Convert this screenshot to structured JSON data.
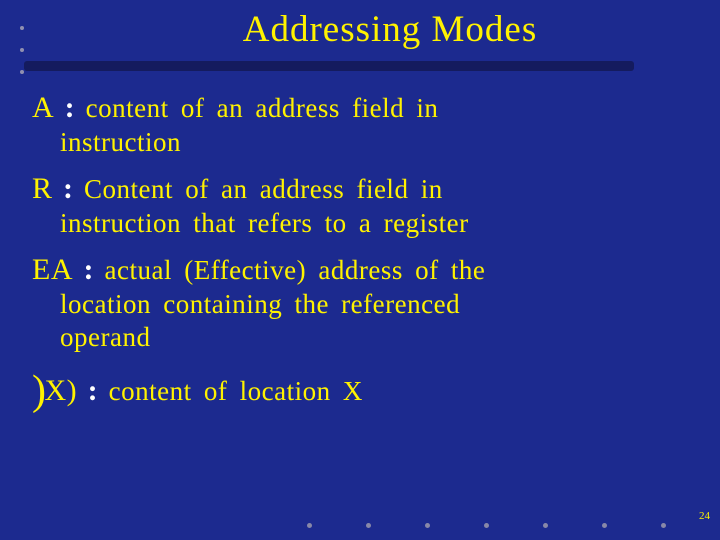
{
  "title": "Addressing  Modes",
  "items": [
    {
      "term": "A",
      "colon": ":",
      "line1": "content  of  an  address  field  in",
      "line2": "instruction"
    },
    {
      "term": "R",
      "colon": ":",
      "line1": "Content  of  an  address  field  in",
      "line2": "instruction  that  refers  to  a  register"
    },
    {
      "term": "EA",
      "colon": ":",
      "line1": "actual (Effective) address  of  the",
      "line2": "location  containing  the  referenced",
      "line3": "operand"
    },
    {
      "bigparen": ")",
      "term": "X)",
      "colon": ":",
      "line1": "content  of  location  X"
    }
  ],
  "pageNumber": "24"
}
